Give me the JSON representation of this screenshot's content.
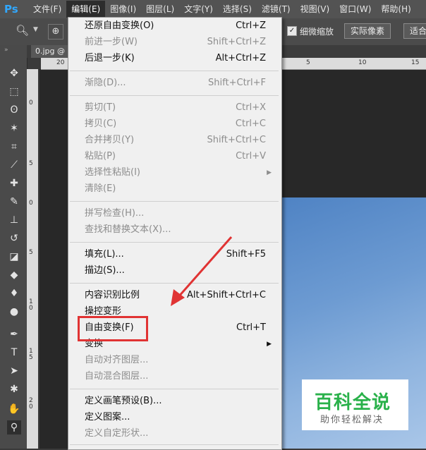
{
  "app": {
    "logo": "Ps"
  },
  "menubar": {
    "items": [
      "文件(F)",
      "编辑(E)",
      "图像(I)",
      "图层(L)",
      "文字(Y)",
      "选择(S)",
      "滤镜(T)",
      "视图(V)",
      "窗口(W)",
      "帮助(H)"
    ],
    "active": "编辑(E)"
  },
  "options": {
    "check_label": "细微缩放",
    "btn_actual": "实际像素",
    "btn_fit": "适合"
  },
  "document": {
    "tab": "0.jpg @"
  },
  "rulers": {
    "h": [
      "20",
      "5",
      "10",
      "15"
    ],
    "v": [
      "0",
      "5",
      "0",
      "5",
      "10",
      "15",
      "20"
    ]
  },
  "edit_menu": {
    "items": [
      {
        "label": "还原自由变换(O)",
        "shortcut": "Ctrl+Z",
        "disabled": false
      },
      {
        "label": "前进一步(W)",
        "shortcut": "Shift+Ctrl+Z",
        "disabled": true
      },
      {
        "label": "后退一步(K)",
        "shortcut": "Alt+Ctrl+Z",
        "disabled": false
      },
      {
        "label": "渐隐(D)...",
        "shortcut": "Shift+Ctrl+F",
        "disabled": true
      },
      {
        "label": "剪切(T)",
        "shortcut": "Ctrl+X",
        "disabled": true
      },
      {
        "label": "拷贝(C)",
        "shortcut": "Ctrl+C",
        "disabled": true
      },
      {
        "label": "合并拷贝(Y)",
        "shortcut": "Shift+Ctrl+C",
        "disabled": true
      },
      {
        "label": "粘贴(P)",
        "shortcut": "Ctrl+V",
        "disabled": true
      },
      {
        "label": "选择性粘贴(I)",
        "shortcut": "",
        "disabled": true,
        "submenu": true
      },
      {
        "label": "清除(E)",
        "shortcut": "",
        "disabled": true
      },
      {
        "label": "拼写检查(H)...",
        "shortcut": "",
        "disabled": true
      },
      {
        "label": "查找和替换文本(X)...",
        "shortcut": "",
        "disabled": true
      },
      {
        "label": "填充(L)...",
        "shortcut": "Shift+F5",
        "disabled": false
      },
      {
        "label": "描边(S)...",
        "shortcut": "",
        "disabled": false
      },
      {
        "label": "内容识别比例",
        "shortcut": "Alt+Shift+Ctrl+C",
        "disabled": false
      },
      {
        "label": "操控变形",
        "shortcut": "",
        "disabled": false
      },
      {
        "label": "自由变换(F)",
        "shortcut": "Ctrl+T",
        "disabled": false
      },
      {
        "label": "变换",
        "shortcut": "",
        "disabled": false,
        "submenu": true
      },
      {
        "label": "自动对齐图层...",
        "shortcut": "",
        "disabled": true
      },
      {
        "label": "自动混合图层...",
        "shortcut": "",
        "disabled": true
      },
      {
        "label": "定义画笔预设(B)...",
        "shortcut": "",
        "disabled": false
      },
      {
        "label": "定义图案...",
        "shortcut": "",
        "disabled": false
      },
      {
        "label": "定义自定形状...",
        "shortcut": "",
        "disabled": true
      }
    ]
  },
  "watermark": {
    "title": "百科全说",
    "subtitle": "助你轻松解决"
  },
  "colors": {
    "highlight": "#e03333",
    "watermark_green": "#29b14a",
    "menu_bg": "#f0f0f0"
  },
  "tools": [
    "move-icon",
    "marquee-icon",
    "lasso-icon",
    "magic-wand-icon",
    "crop-icon",
    "eyedropper-icon",
    "spot-heal-icon",
    "brush-icon",
    "stamp-icon",
    "history-brush-icon",
    "eraser-icon",
    "bucket-icon",
    "blur-icon",
    "dodge-icon",
    "pen-icon",
    "text-icon",
    "path-select-icon",
    "shape-icon",
    "hand-icon",
    "zoom-icon"
  ]
}
